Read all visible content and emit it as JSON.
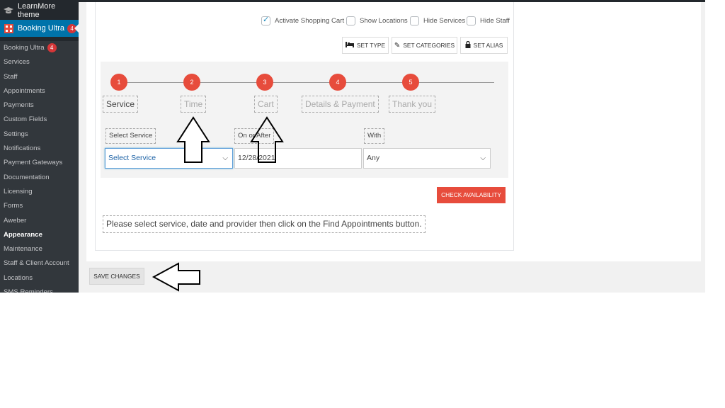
{
  "sidebar": {
    "site_name": "LearnMore theme",
    "plugin_name": "Booking Ultra",
    "plugin_badge": "4",
    "items": [
      {
        "label": "Booking Ultra",
        "badge": "4"
      },
      {
        "label": "Services"
      },
      {
        "label": "Staff"
      },
      {
        "label": "Appointments"
      },
      {
        "label": "Payments"
      },
      {
        "label": "Custom Fields"
      },
      {
        "label": "Settings"
      },
      {
        "label": "Notifications"
      },
      {
        "label": "Payment Gateways"
      },
      {
        "label": "Documentation"
      },
      {
        "label": "Licensing"
      },
      {
        "label": "Forms"
      },
      {
        "label": "Aweber"
      },
      {
        "label": "Appearance"
      },
      {
        "label": "Maintenance"
      },
      {
        "label": "Staff & Client Account"
      },
      {
        "label": "Locations"
      },
      {
        "label": "SMS Reminders"
      }
    ]
  },
  "options": {
    "activate_cart": "Activate Shopping Cart",
    "show_locations": "Show Locations",
    "hide_services": "Hide Services",
    "hide_staff": "Hide Staff"
  },
  "buttons": {
    "set_type": "SET TYPE",
    "set_categories": "SET CATEGORIES",
    "set_alias": "SET ALIAS",
    "check_availability": "CHECK AVAILABILITY",
    "save_changes": "SAVE CHANGES"
  },
  "steps": [
    {
      "num": "1",
      "label": "Service"
    },
    {
      "num": "2",
      "label": "Time"
    },
    {
      "num": "3",
      "label": "Cart"
    },
    {
      "num": "4",
      "label": "Details & Payment"
    },
    {
      "num": "5",
      "label": "Thank you"
    }
  ],
  "form": {
    "service_label": "Select Service",
    "service_value": "Select Service",
    "date_label": "On or After",
    "date_value": "12/28/2021",
    "with_label": "With",
    "with_value": "Any"
  },
  "hint": "Please select service, date and provider then click on the Find Appointments button.",
  "colors": {
    "accent": "#e74c3c",
    "sidebar_bg": "#23282d",
    "active_menu": "#0073aa"
  }
}
